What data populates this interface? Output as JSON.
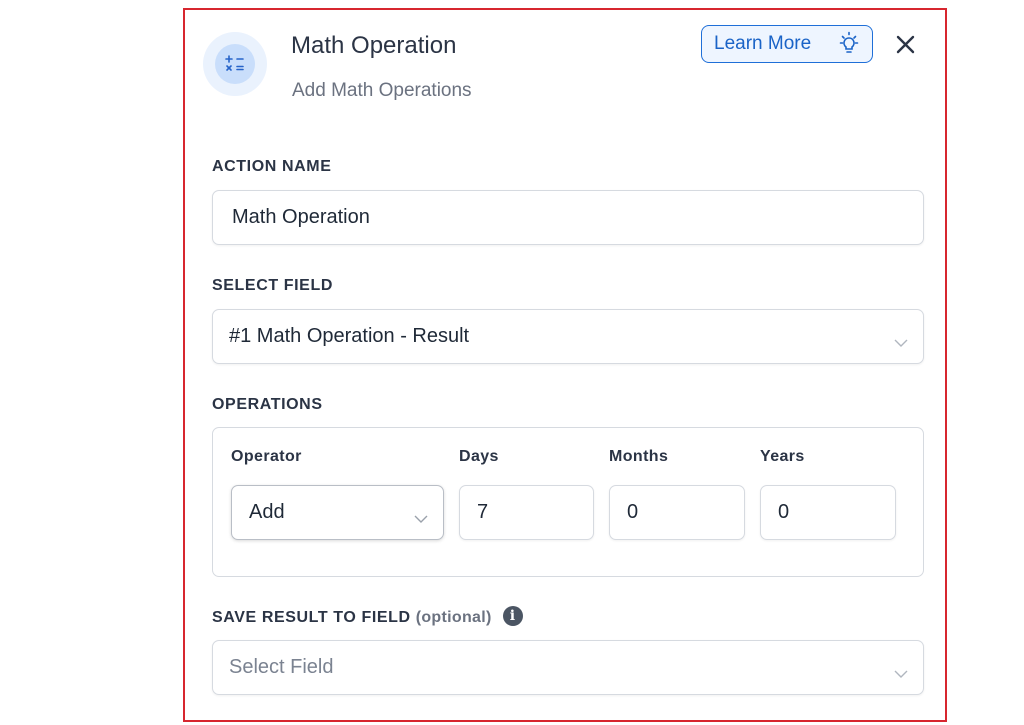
{
  "header": {
    "title": "Math Operation",
    "subtitle": "Add Math Operations",
    "learn_more_label": "Learn More"
  },
  "action_name": {
    "label": "ACTION NAME",
    "value": "Math Operation"
  },
  "select_field": {
    "label": "SELECT FIELD",
    "value": "#1 Math Operation - Result"
  },
  "operations": {
    "label": "OPERATIONS",
    "columns": {
      "operator": "Operator",
      "days": "Days",
      "months": "Months",
      "years": "Years"
    },
    "values": {
      "operator": "Add",
      "days": "7",
      "months": "0",
      "years": "0"
    }
  },
  "save_result": {
    "label": "SAVE RESULT TO FIELD",
    "optional": "(optional)",
    "info_glyph": "i",
    "placeholder": "Select Field"
  },
  "icons": {
    "header": "math-operators-icon",
    "learn_more": "lightbulb-icon",
    "close": "close-icon",
    "dropdown": "chevron-down-icon",
    "info": "info-icon"
  },
  "colors": {
    "panel_border": "#d7262f",
    "accent": "#1f6fd8",
    "header_icon_bg": "#eaf2fd"
  }
}
